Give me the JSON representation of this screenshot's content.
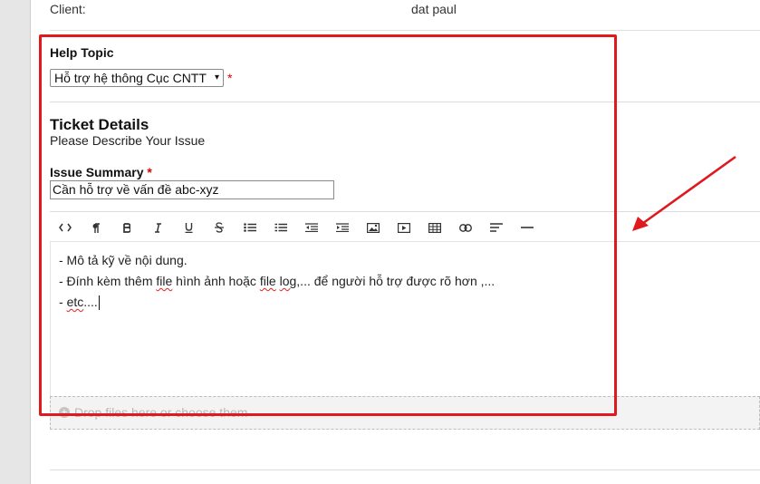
{
  "client": {
    "label": "Client:",
    "value": "dat paul"
  },
  "help_topic": {
    "label": "Help Topic",
    "selected": "Hỗ trợ hệ thông Cục CNTT",
    "arrow": "▾",
    "required_mark": "*"
  },
  "ticket_details": {
    "heading": "Ticket Details",
    "description": "Please Describe Your Issue"
  },
  "issue_summary": {
    "label": "Issue Summary",
    "required_mark": "*",
    "value": "Cần hỗ trợ về vấn đề abc-xyz"
  },
  "toolbar": {
    "buttons": [
      {
        "name": "code-icon",
        "glyph": "<>"
      },
      {
        "name": "paragraph-icon",
        "glyph": "¶"
      },
      {
        "name": "bold-icon",
        "glyph": "B"
      },
      {
        "name": "italic-icon",
        "glyph": "I"
      },
      {
        "name": "underline-icon",
        "glyph": "U"
      },
      {
        "name": "strikethrough-icon",
        "glyph": "S"
      },
      {
        "name": "unordered-list-icon",
        "glyph": ""
      },
      {
        "name": "ordered-list-icon",
        "glyph": ""
      },
      {
        "name": "outdent-icon",
        "glyph": ""
      },
      {
        "name": "indent-icon",
        "glyph": ""
      },
      {
        "name": "image-icon",
        "glyph": ""
      },
      {
        "name": "video-icon",
        "glyph": ""
      },
      {
        "name": "table-icon",
        "glyph": ""
      },
      {
        "name": "link-icon",
        "glyph": ""
      },
      {
        "name": "align-icon",
        "glyph": ""
      },
      {
        "name": "horizontal-rule-icon",
        "glyph": ""
      }
    ]
  },
  "editor": {
    "line1": "- Mô tả kỹ về nội dung.",
    "line2_a": "- Đính kèm thêm ",
    "line2_file1": "file",
    "line2_b": " hình ảnh hoặc ",
    "line2_file2": "file",
    "line2_c": " ",
    "line2_log": "log",
    "line2_d": ",... để người hỗ trợ được rõ hơn ,...",
    "line3_a": "- ",
    "line3_etc": "etc",
    "line3_b": "...."
  },
  "dropzone": {
    "text": "Drop files here or choose them",
    "icon": "+"
  },
  "colors": {
    "highlight": "#e0191f",
    "required": "#dd0000"
  }
}
